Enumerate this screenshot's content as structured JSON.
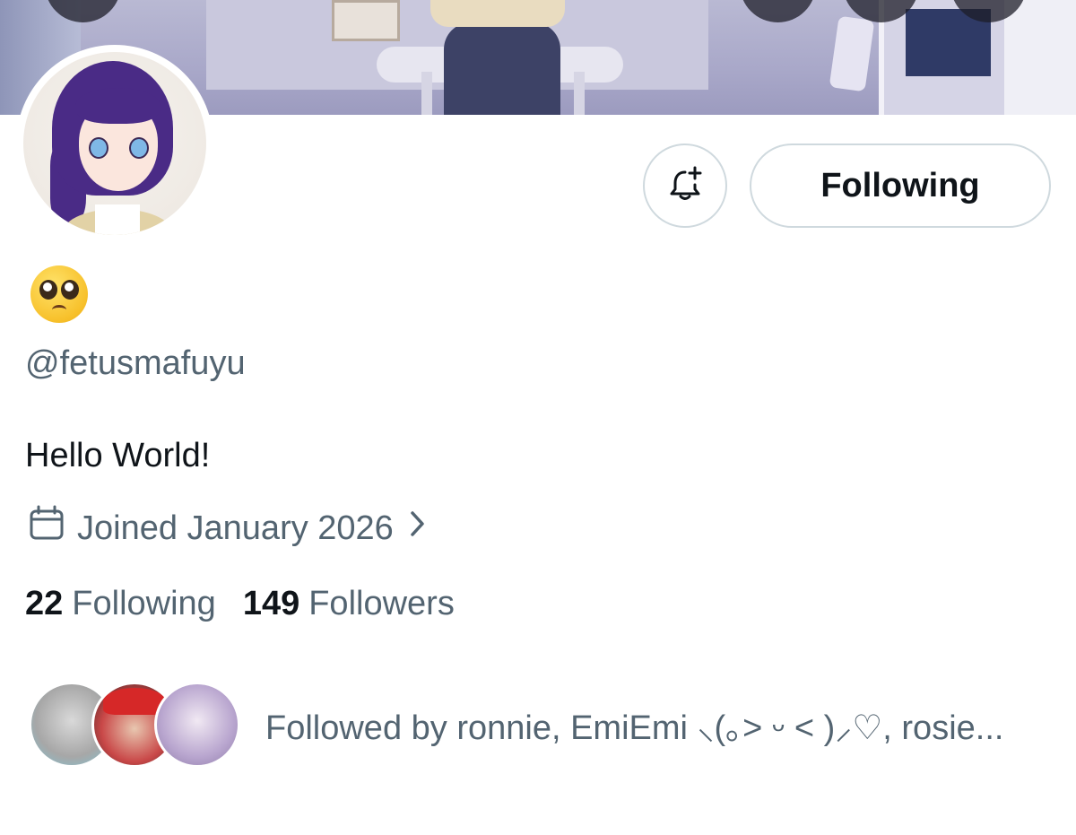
{
  "profile": {
    "display_name_emoji": "pleading-face",
    "handle": "@fetusmafuyu",
    "bio": "Hello World!",
    "joined": "Joined January 2026",
    "following_count": "22",
    "following_label": "Following",
    "followers_count": "149",
    "followers_label": "Followers",
    "followed_by": "Followed by ronnie, EmiEmi ⸜(｡˃ ᵕ ˂ )⸝♡, rosie..."
  },
  "actions": {
    "follow_label": "Following",
    "notify_icon": "bell-plus-icon"
  },
  "icons": {
    "calendar": "calendar-icon",
    "chevron": "chevron-right-icon"
  },
  "colors": {
    "text_primary": "#0f1419",
    "text_secondary": "#536471",
    "border": "#cfd9de"
  }
}
